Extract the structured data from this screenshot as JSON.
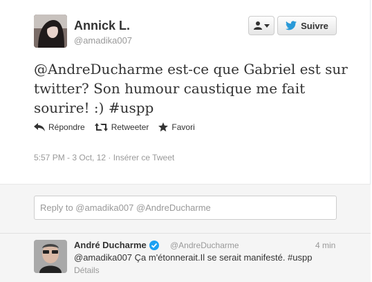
{
  "tweet": {
    "author_name": "Annick L.",
    "author_handle": "@amadika007",
    "text": "@AndreDucharme est-ce que Gabriel est sur twitter? Son humour caustique me fait sourire! :) #uspp",
    "timestamp": "5:57 PM - 3 Oct, 12 · Insérer ce Tweet"
  },
  "buttons": {
    "follow_label": "Suivre"
  },
  "actions": {
    "reply": "Répondre",
    "retweet": "Retweeter",
    "favorite": "Favori"
  },
  "reply_box": {
    "placeholder": "Reply to @amadika007 @AndreDucharme"
  },
  "reply": {
    "author_name": "André Ducharme",
    "author_handle": "@AndreDucharme",
    "time": "4 min",
    "text": "@amadika007 Ça m'étonnerait.Il se serait manifesté. #uspp",
    "details": "Détails"
  },
  "colors": {
    "twitter_blue": "#2a9ad8",
    "verified_blue": "#1da1f2",
    "muted": "#999999"
  }
}
